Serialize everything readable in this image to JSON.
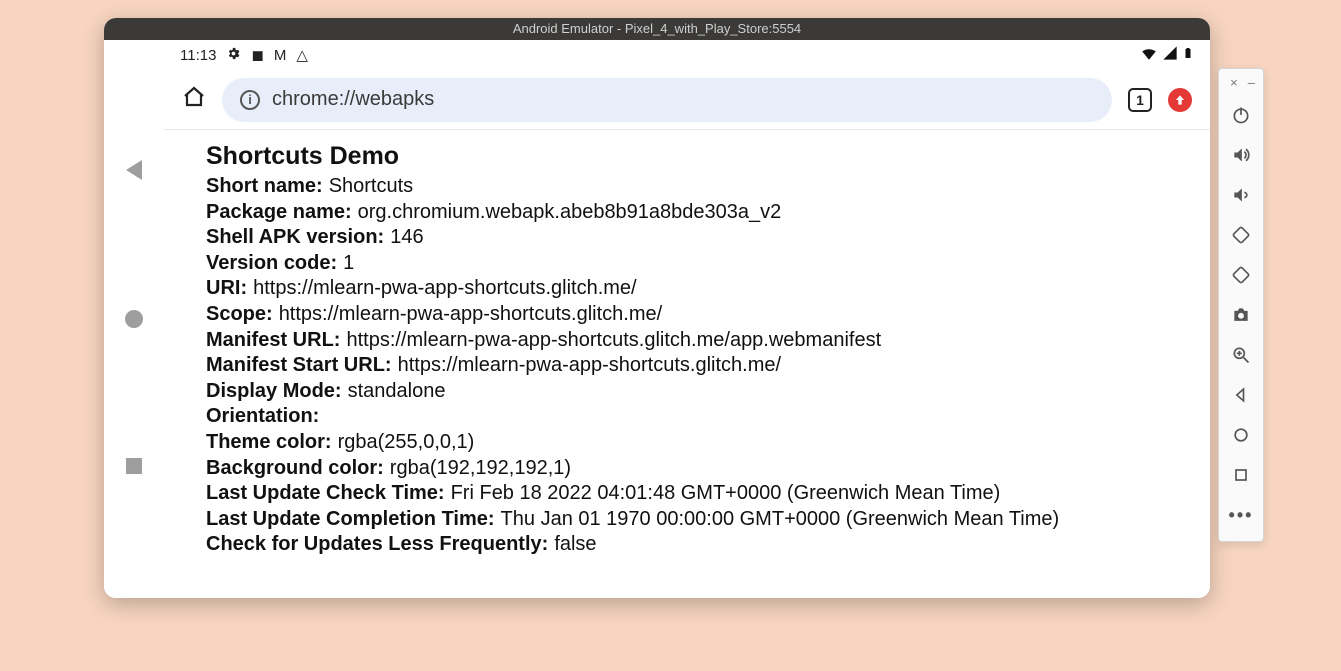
{
  "window": {
    "title": "Android Emulator - Pixel_4_with_Play_Store:5554"
  },
  "statusbar": {
    "time": "11:13"
  },
  "chrome": {
    "url": "chrome://webapks",
    "tab_count": "1"
  },
  "page": {
    "title": "Shortcuts Demo",
    "fields": [
      {
        "label": "Short name:",
        "value": "Shortcuts"
      },
      {
        "label": "Package name:",
        "value": "org.chromium.webapk.abeb8b91a8bde303a_v2"
      },
      {
        "label": "Shell APK version:",
        "value": "146"
      },
      {
        "label": "Version code:",
        "value": "1"
      },
      {
        "label": "URI:",
        "value": "https://mlearn-pwa-app-shortcuts.glitch.me/"
      },
      {
        "label": "Scope:",
        "value": "https://mlearn-pwa-app-shortcuts.glitch.me/"
      },
      {
        "label": "Manifest URL:",
        "value": "https://mlearn-pwa-app-shortcuts.glitch.me/app.webmanifest"
      },
      {
        "label": "Manifest Start URL:",
        "value": "https://mlearn-pwa-app-shortcuts.glitch.me/"
      },
      {
        "label": "Display Mode:",
        "value": "standalone"
      },
      {
        "label": "Orientation:",
        "value": ""
      },
      {
        "label": "Theme color:",
        "value": "rgba(255,0,0,1)"
      },
      {
        "label": "Background color:",
        "value": "rgba(192,192,192,1)"
      },
      {
        "label": "Last Update Check Time:",
        "value": "Fri Feb 18 2022 04:01:48 GMT+0000 (Greenwich Mean Time)"
      },
      {
        "label": "Last Update Completion Time:",
        "value": "Thu Jan 01 1970 00:00:00 GMT+0000 (Greenwich Mean Time)"
      },
      {
        "label": "Check for Updates Less Frequently:",
        "value": "false"
      }
    ]
  }
}
